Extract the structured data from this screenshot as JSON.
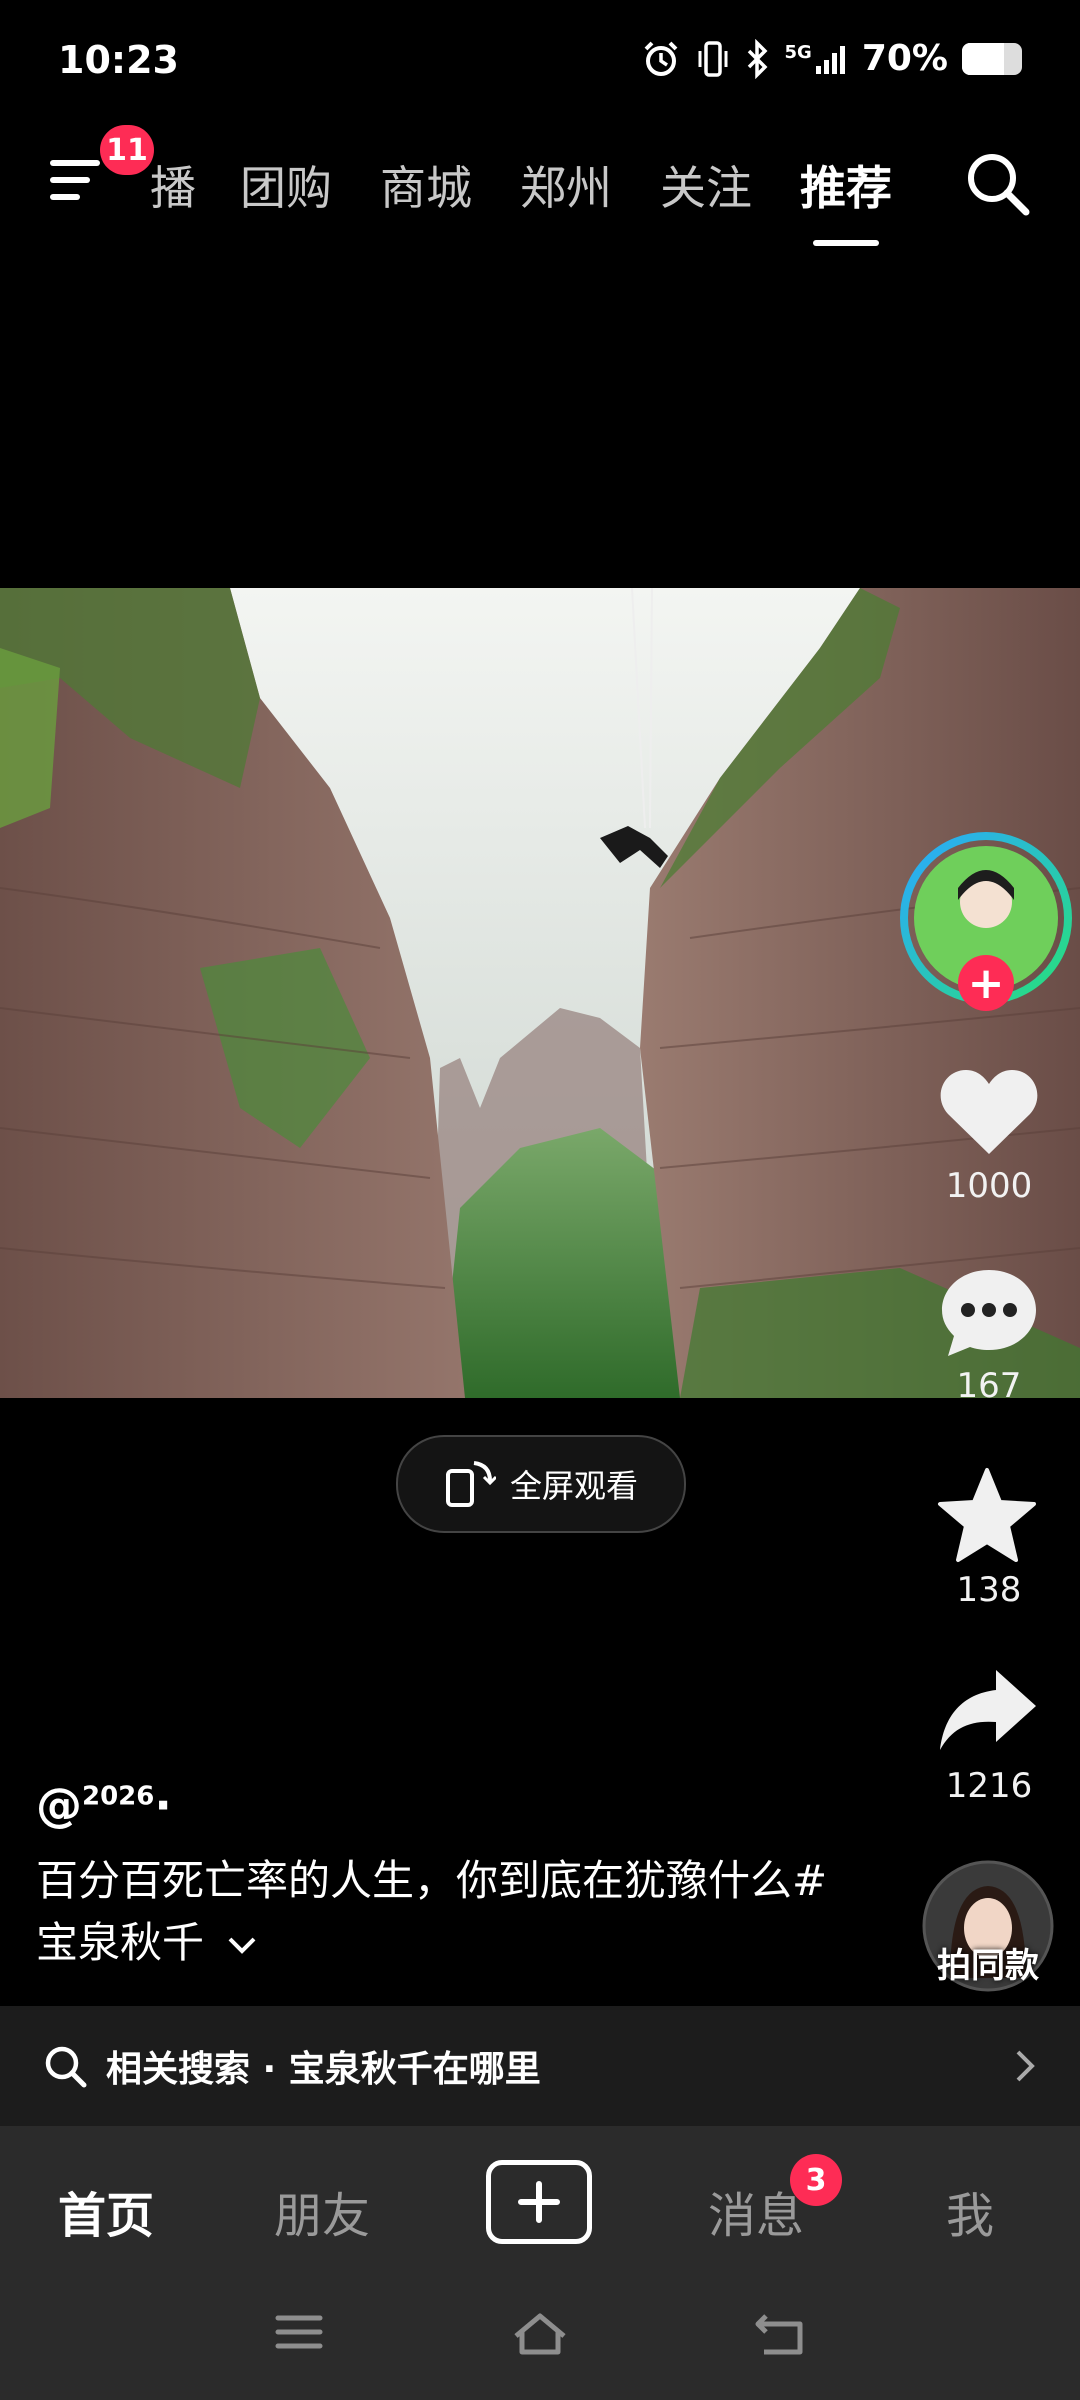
{
  "status_bar": {
    "time": "10:23",
    "network": "5G",
    "battery_percent": "70%",
    "battery_level": 0.7,
    "icons": [
      "alarm-icon",
      "vibrate-icon",
      "bluetooth-icon",
      "signal-icon",
      "battery-icon"
    ]
  },
  "top_nav": {
    "menu_badge": "11",
    "tabs": [
      {
        "label": "播",
        "partial": true
      },
      {
        "label": "团购"
      },
      {
        "label": "商城"
      },
      {
        "label": "郑州"
      },
      {
        "label": "关注"
      },
      {
        "label": "推荐",
        "active": true
      }
    ]
  },
  "right_rail": {
    "likes": "1000",
    "comments": "167",
    "favorites": "138",
    "shares": "1216",
    "same_style_label": "拍同款"
  },
  "fullscreen": {
    "label": "全屏观看"
  },
  "post": {
    "author_prefix": "@",
    "author_super": "2026",
    "author_suffix": "·",
    "caption": "百分百死亡率的人生，你到底在犹豫什么#宝泉秋千"
  },
  "related_search": {
    "text": "相关搜索 · 宝泉秋千在哪里"
  },
  "bottom_nav": {
    "items": [
      {
        "label": "首页",
        "active": true
      },
      {
        "label": "朋友"
      },
      {
        "label": "消息"
      },
      {
        "label": "我"
      }
    ],
    "message_badge": "3"
  },
  "colors": {
    "accent": "#fe2c55",
    "background": "#000000",
    "bottom_nav_bg": "#2b2b2b"
  }
}
